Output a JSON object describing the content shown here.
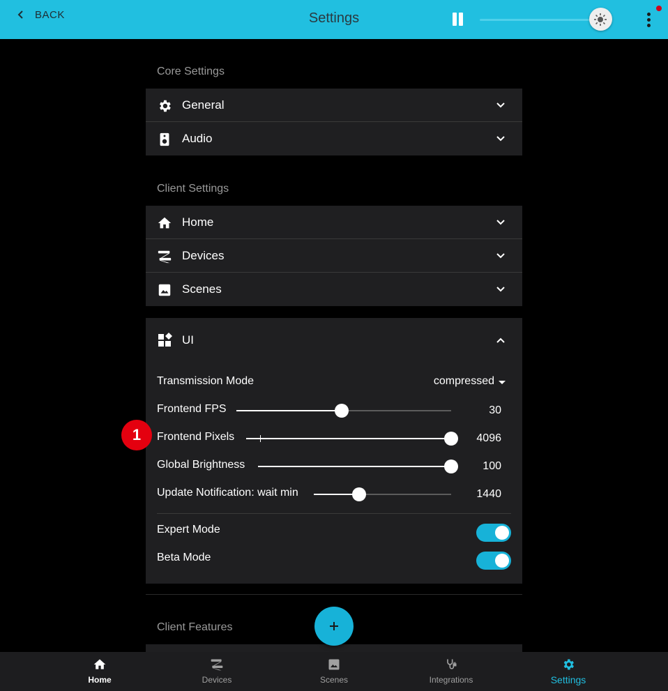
{
  "appbar": {
    "back_label": "BACK",
    "title": "Settings",
    "brightness_level": 0.93
  },
  "core": {
    "label": "Core Settings",
    "items": [
      {
        "label": "General",
        "icon": "gear-icon"
      },
      {
        "label": "Audio",
        "icon": "speaker-icon"
      }
    ]
  },
  "client": {
    "label": "Client Settings",
    "items": [
      {
        "label": "Home",
        "icon": "home-icon"
      },
      {
        "label": "Devices",
        "icon": "led-strip-icon"
      },
      {
        "label": "Scenes",
        "icon": "image-icon"
      }
    ]
  },
  "ui": {
    "label": "UI",
    "transmission": {
      "label": "Transmission Mode",
      "value": "compressed"
    },
    "sliders": [
      {
        "label": "Frontend FPS",
        "value": "30",
        "fraction": 0.49
      },
      {
        "label": "Frontend Pixels",
        "value": "4096",
        "fraction": 1.0
      },
      {
        "label": "Global Brightness",
        "value": "100",
        "fraction": 1.0
      },
      {
        "label": "Update Notification: wait min",
        "value": "1440",
        "fraction": 0.33
      }
    ],
    "toggles": [
      {
        "label": "Expert Mode",
        "on": true
      },
      {
        "label": "Beta Mode",
        "on": true
      }
    ]
  },
  "features": {
    "label": "Client Features"
  },
  "badge": "1",
  "nav": [
    {
      "label": "Home",
      "icon": "home-icon"
    },
    {
      "label": "Devices",
      "icon": "led-strip-icon"
    },
    {
      "label": "Scenes",
      "icon": "image-icon"
    },
    {
      "label": "Integrations",
      "icon": "plug-icon"
    },
    {
      "label": "Settings",
      "icon": "gear-icon"
    }
  ],
  "colors": {
    "accent": "#21bfe0",
    "toggle": "#17b2d8",
    "badge": "#e4000f",
    "panel": "#1f1f21"
  }
}
